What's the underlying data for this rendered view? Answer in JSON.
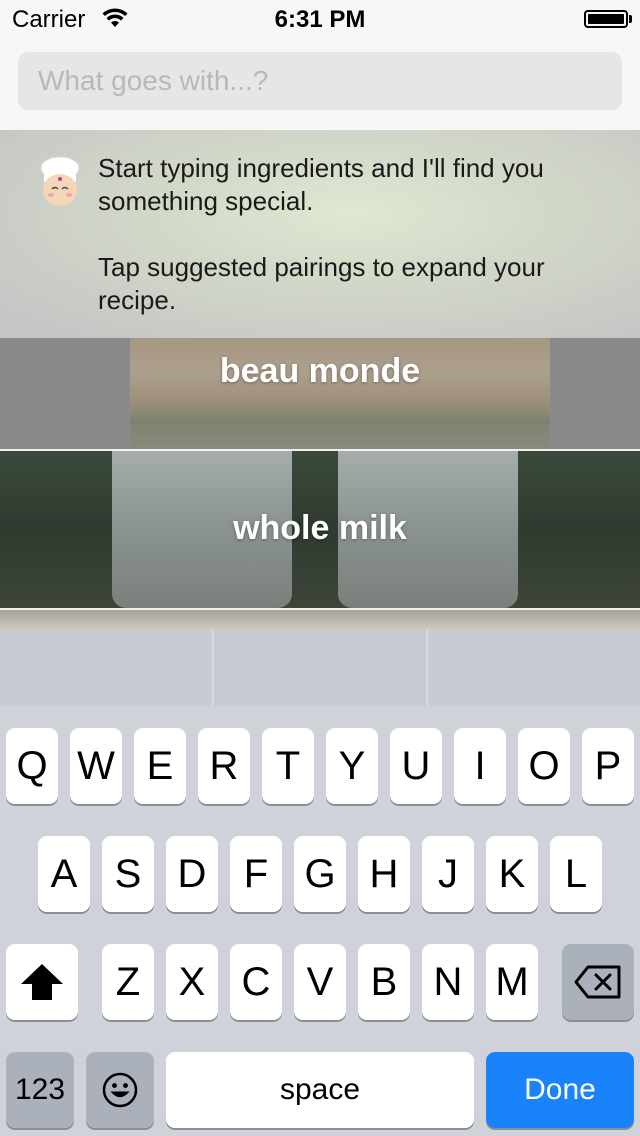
{
  "status_bar": {
    "carrier": "Carrier",
    "time": "6:31 PM"
  },
  "search": {
    "placeholder": "What goes with...?"
  },
  "intro": {
    "line1": "Start typing ingredients and I'll find you something special.",
    "line2": "Tap suggested pairings to expand your recipe."
  },
  "pairings": [
    {
      "label": "beau monde"
    },
    {
      "label": "whole milk"
    }
  ],
  "keyboard": {
    "row1": [
      "Q",
      "W",
      "E",
      "R",
      "T",
      "Y",
      "U",
      "I",
      "O",
      "P"
    ],
    "row2": [
      "A",
      "S",
      "D",
      "F",
      "G",
      "H",
      "J",
      "K",
      "L"
    ],
    "row3": [
      "Z",
      "X",
      "C",
      "V",
      "B",
      "N",
      "M"
    ],
    "numbers_label": "123",
    "space_label": "space",
    "done_label": "Done",
    "accent_color": "#1a82fb"
  }
}
